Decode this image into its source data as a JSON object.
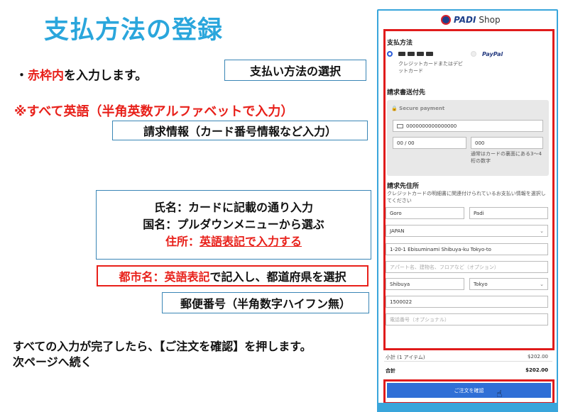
{
  "slide": {
    "title": "支払方法の登録",
    "bullet_prefix": "・",
    "bullet_red": "赤枠内",
    "bullet_rest": "を入力します。",
    "warning": "※すべて英語（半角英数アルファベットで入力）",
    "callout_payment": "支払い方法の選択",
    "callout_billing": "請求情報（カード番号情報など入力）",
    "callout_name": "氏名：カードに記載の通り入力",
    "callout_country": "国名：プルダウンメニューから選ぶ",
    "callout_address": "住所：英語表記で入力する",
    "callout_address_label": "住所：",
    "callout_address_value": "英語表記で入力する",
    "callout_city_red": "都市名：英語表記",
    "callout_city_rest": "で記入し、都道府県を選択",
    "callout_zip": "郵便番号（半角数字ハイフン無）",
    "footer_line1": "すべての入力が完了したら、【ご注文を確認】を押します。",
    "footer_line2": "次ページへ続く"
  },
  "shop": {
    "logo_padi": "PADI",
    "logo_shop": "Shop",
    "payment_method_title": "支払方法",
    "card_option_label": "クレジットカードまたはデビットカード",
    "paypal_label": "PayPal",
    "billing_address_title": "請求書送付先",
    "secure_payment": "Secure payment",
    "card_number": "0000000000000000",
    "expiry": "00 / 00",
    "cvc": "000",
    "cvc_help": "通常はカードの裏面にある3～4桁の数字",
    "billing_contact_title": "請求先住所",
    "billing_contact_help": "クレジットカードの明細書に関連付けられているお支払い情報を選択してください",
    "first_name": "Goro",
    "last_name": "Padi",
    "country": "JAPAN",
    "address1": "1-20-1 Ebisuminami Shibuya-ku Tokyo-to",
    "address2_placeholder": "アパート名、建物名、フロアなど（オプション）",
    "city": "Shibuya",
    "prefecture": "Tokyo",
    "postal_code": "1500022",
    "phone_placeholder": "電話番号（オプショナル）",
    "subtotal_label": "小計 (1 アイテム)",
    "subtotal_value": "$202.00",
    "total_label": "合計",
    "total_value": "$202.00",
    "submit_label": "ご注文を確認"
  },
  "colors": {
    "accent": "#2aa6dc",
    "alert_red": "#e8201a",
    "button_blue": "#2f6fd6"
  }
}
